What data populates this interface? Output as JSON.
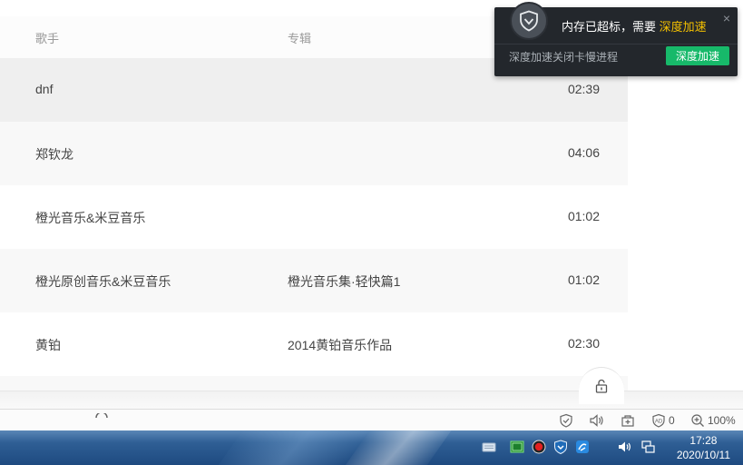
{
  "table": {
    "headers": {
      "artist": "歌手",
      "album": "专辑"
    },
    "rows": [
      {
        "artist": "dnf",
        "album": "",
        "duration": "02:39"
      },
      {
        "artist": "郑钦龙",
        "album": "",
        "duration": "04:06"
      },
      {
        "artist": "橙光音乐&米豆音乐",
        "album": "",
        "duration": "01:02"
      },
      {
        "artist": "橙光原创音乐&米豆音乐",
        "album": "橙光音乐集·轻快篇1",
        "duration": "01:02"
      },
      {
        "artist": "黄铂",
        "album": "2014黄铂音乐作品",
        "duration": "02:30"
      }
    ]
  },
  "popup": {
    "message_prefix": "内存已超标，需要",
    "message_highlight": "深度加速",
    "close": "×",
    "description": "深度加速关闭卡慢进程",
    "button": "深度加速"
  },
  "statusbar": {
    "blocked_count": "0",
    "zoom": "100%"
  },
  "taskbar": {
    "time": "17:28",
    "date": "2020/10/11"
  },
  "colors": {
    "accent_green": "#17b96a",
    "highlight_yellow": "#f4c000",
    "popup_bg": "#23272c"
  }
}
